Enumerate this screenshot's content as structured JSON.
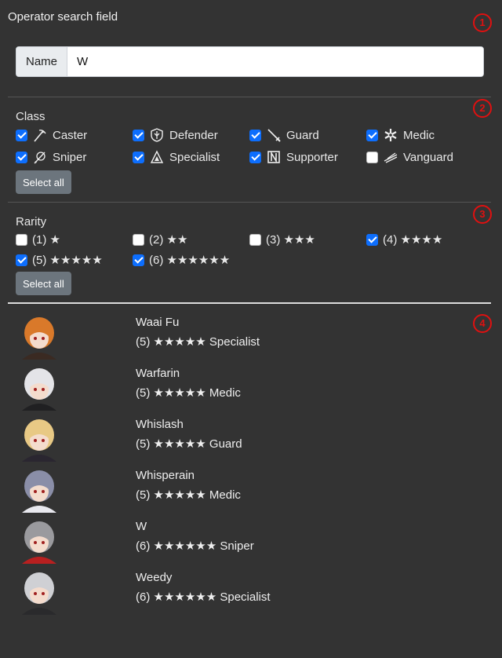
{
  "header": {
    "title": "Operator search field"
  },
  "markers": [
    "1",
    "2",
    "3",
    "4"
  ],
  "name_filter": {
    "label": "Name",
    "value": "W"
  },
  "class_filter": {
    "label": "Class",
    "items": [
      {
        "label": "Caster",
        "checked": true,
        "icon": "caster-icon"
      },
      {
        "label": "Defender",
        "checked": true,
        "icon": "defender-icon"
      },
      {
        "label": "Guard",
        "checked": true,
        "icon": "guard-icon"
      },
      {
        "label": "Medic",
        "checked": true,
        "icon": "medic-icon"
      },
      {
        "label": "Sniper",
        "checked": true,
        "icon": "sniper-icon"
      },
      {
        "label": "Specialist",
        "checked": true,
        "icon": "specialist-icon"
      },
      {
        "label": "Supporter",
        "checked": true,
        "icon": "supporter-icon"
      },
      {
        "label": "Vanguard",
        "checked": false,
        "icon": "vanguard-icon"
      }
    ],
    "select_all": "Select all"
  },
  "rarity_filter": {
    "label": "Rarity",
    "items": [
      {
        "label": "(1) ★",
        "checked": false
      },
      {
        "label": "(2) ★★",
        "checked": false
      },
      {
        "label": "(3) ★★★",
        "checked": false
      },
      {
        "label": "(4) ★★★★",
        "checked": true
      },
      {
        "label": "(5) ★★★★★",
        "checked": true
      },
      {
        "label": "(6) ★★★★★★",
        "checked": true
      }
    ],
    "select_all": "Select all"
  },
  "results": [
    {
      "name": "Waai Fu",
      "info": "(5) ★★★★★ Specialist",
      "hair": "#d9792a",
      "accent": "#3a2a22"
    },
    {
      "name": "Warfarin",
      "info": "(5) ★★★★★ Medic",
      "hair": "#e4e4e8",
      "accent": "#202022"
    },
    {
      "name": "Whislash",
      "info": "(5) ★★★★★ Guard",
      "hair": "#e8c985",
      "accent": "#2a2630"
    },
    {
      "name": "Whisperain",
      "info": "(5) ★★★★★ Medic",
      "hair": "#8a8ea8",
      "accent": "#e8e8ee"
    },
    {
      "name": "W",
      "info": "(6) ★★★★★★ Sniper",
      "hair": "#9a9a9e",
      "accent": "#b82020"
    },
    {
      "name": "Weedy",
      "info": "(6) ★★★★★★ Specialist",
      "hair": "#cfd0d4",
      "accent": "#2a2a2c"
    }
  ]
}
